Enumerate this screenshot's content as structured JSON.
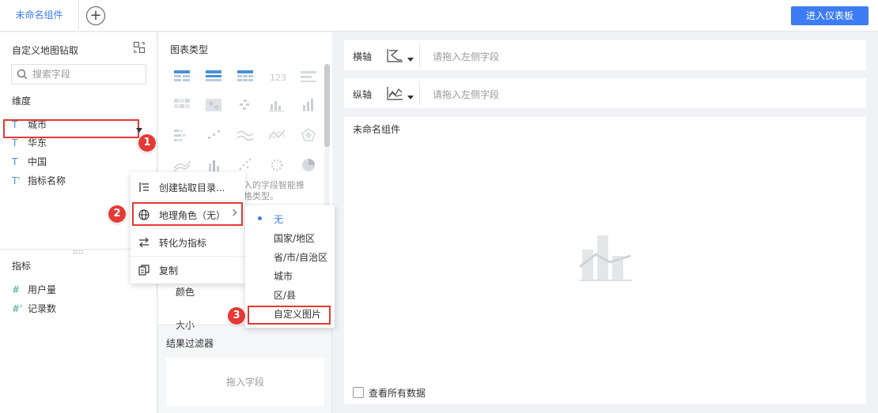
{
  "topbar": {
    "active_tab": "未命名组件",
    "add_tab_symbol": "+",
    "enter_dashboard": "进入仪表板"
  },
  "left": {
    "title": "自定义地图钻取",
    "search_placeholder": "搜索字段",
    "dimensions_label": "维度",
    "dimensions": [
      {
        "type": "T",
        "name": "城市"
      },
      {
        "type": "T",
        "name": "华东"
      },
      {
        "type": "T",
        "name": "中国"
      },
      {
        "type": "T'",
        "name": "指标名称"
      }
    ],
    "measures_label": "指标",
    "measures": [
      {
        "type": "#",
        "name": "用户量"
      },
      {
        "type": "#'",
        "name": "记录数"
      }
    ]
  },
  "mid": {
    "chart_type_title": "图表类型",
    "hint_line1": "入的字段智能推",
    "hint_line2": "格类型。",
    "color_label": "颜色",
    "size_label": "大小",
    "filter_title": "结果过滤器",
    "filter_drop": "拖入字段"
  },
  "axes": {
    "x_label": "横轴",
    "x_placeholder": "请拖入左侧字段",
    "y_label": "纵轴",
    "y_placeholder": "请拖入左侧字段"
  },
  "canvas": {
    "title": "未命名组件",
    "show_all": "查看所有数据"
  },
  "context_menu": {
    "items": [
      "创建钻取目录...",
      "地理角色（无）",
      "转化为指标",
      "复制"
    ]
  },
  "submenu": {
    "items": [
      "无",
      "国家/地区",
      "省/市/自治区",
      "城市",
      "区/县",
      "自定义图片"
    ],
    "selected": "无"
  },
  "badges": [
    "1",
    "2",
    "3"
  ],
  "colors": {
    "accent": "#3d7cf2",
    "highlight": "#e53935"
  }
}
